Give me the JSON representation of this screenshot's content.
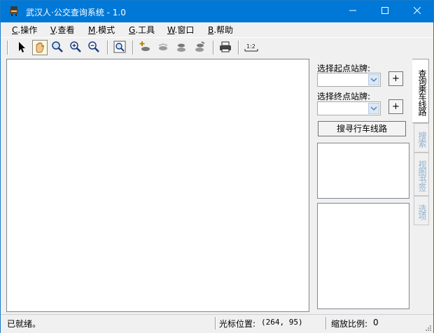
{
  "window": {
    "title": "武汉人·公交查询系统 - 1.0"
  },
  "menu": [
    {
      "key": "C",
      "label": ".操作"
    },
    {
      "key": "V",
      "label": ".查看"
    },
    {
      "key": "M",
      "label": ".模式"
    },
    {
      "key": "G",
      "label": ".工具"
    },
    {
      "key": "W",
      "label": ".窗口"
    },
    {
      "key": "B",
      "label": ".帮助"
    }
  ],
  "toolbar": {
    "tools": [
      "pointer-icon",
      "hand-pan-icon",
      "zoom-extent-icon",
      "zoom-in-icon",
      "zoom-out-icon",
      "zoom-window-icon",
      "add-route-icon",
      "route-1-icon",
      "route-2-icon",
      "route-3-icon",
      "print-icon",
      "scale-icon"
    ],
    "active_tool": "hand-pan-icon",
    "scale_label": "1:2"
  },
  "side": {
    "start_label": "选择起点站牌:",
    "end_label": "选择终点站牌:",
    "start_value": "",
    "end_value": "",
    "plus": "+",
    "search_button": "搜寻行车线路"
  },
  "tabs": [
    {
      "label": "查询乘车线路",
      "active": true
    },
    {
      "label": "搜索",
      "active": false
    },
    {
      "label": "视图书签",
      "active": false
    },
    {
      "label": "选项",
      "active": false
    }
  ],
  "status": {
    "ready": "已就绪。",
    "cursor_label": "光标位置:",
    "cursor_value": "(264, 95)",
    "scale_label": "缩放比例:",
    "scale_value": "0"
  },
  "colors": {
    "titlebar": "#0078d7",
    "tab_inactive_text": "#8fb0d0"
  }
}
